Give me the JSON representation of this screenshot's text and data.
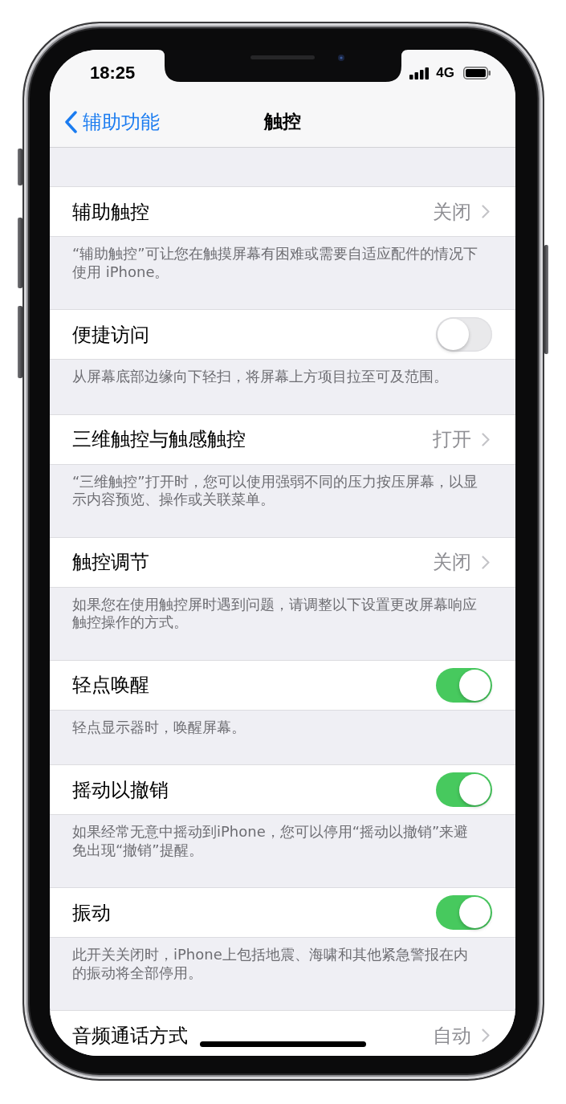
{
  "status_bar": {
    "time": "18:25",
    "network": "4G"
  },
  "nav_bar": {
    "back_label": "辅助功能",
    "title": "触控"
  },
  "settings": [
    {
      "kind": "link",
      "label": "辅助触控",
      "value": "关闭",
      "footer": "“辅助触控”可让您在触摸屏幕有困难或需要自适应配件的情况下使用 iPhone。"
    },
    {
      "kind": "toggle",
      "label": "便捷访问",
      "on": false,
      "footer": "从屏幕底部边缘向下轻扫，将屏幕上方项目拉至可及范围。"
    },
    {
      "kind": "link",
      "label": "三维触控与触感触控",
      "value": "打开",
      "footer": "“三维触控”打开时，您可以使用强弱不同的压力按压屏幕，以显示内容预览、操作或关联菜单。"
    },
    {
      "kind": "link",
      "label": "触控调节",
      "value": "关闭",
      "footer": "如果您在使用触控屏时遇到问题，请调整以下设置更改屏幕响应触控操作的方式。"
    },
    {
      "kind": "toggle",
      "label": "轻点唤醒",
      "on": true,
      "footer": "轻点显示器时，唤醒屏幕。"
    },
    {
      "kind": "toggle",
      "label": "摇动以撤销",
      "on": true,
      "footer": "如果经常无意中摇动到iPhone，您可以停用“摇动以撤销”来避免出现“撤销”提醒。"
    },
    {
      "kind": "toggle",
      "label": "振动",
      "on": true,
      "footer": "此开关关闭时，iPhone上包括地震、海啸和其他紧急警报在内的振动将全部停用。"
    },
    {
      "kind": "link",
      "label": "音频通话方式",
      "value": "自动"
    }
  ]
}
